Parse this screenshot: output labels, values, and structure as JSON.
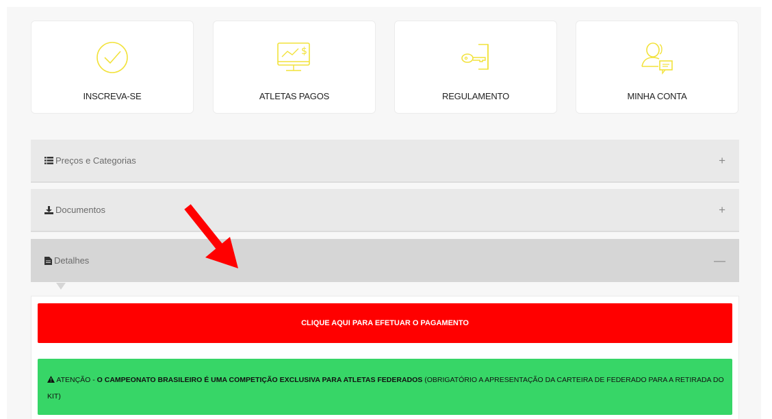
{
  "cards": [
    {
      "label": "INSCREVA-SE",
      "icon": "check-circle-icon"
    },
    {
      "label": "ATLETAS PAGOS",
      "icon": "monitor-money-icon"
    },
    {
      "label": "REGULAMENTO",
      "icon": "key-door-icon"
    },
    {
      "label": "MINHA CONTA",
      "icon": "user-chat-icon"
    }
  ],
  "accordion": {
    "items": [
      {
        "title": "Preços e Categorias",
        "icon": "list-icon",
        "toggle": "+"
      },
      {
        "title": "Documentos",
        "icon": "download-icon",
        "toggle": "+"
      },
      {
        "title": "Detalhes",
        "icon": "file-icon",
        "toggle": "—"
      }
    ]
  },
  "details": {
    "pay_button": "CLIQUE AQUI PARA EFETUAR O PAGAMENTO",
    "notice": {
      "prefix": "ATENÇÃO - ",
      "bold": "O CAMPEONATO BRASILEIRO É UMA COMPETIÇÃO EXCLUSIVA PARA ATLETAS FEDERADOS",
      "rest": " (OBRIGATÓRIO A APRESENTAÇÃO DA CARTEIRA DE FEDERADO PARA A RETIRADA DO KIT)"
    }
  },
  "colors": {
    "icon_yellow": "#f2e23a",
    "pay_red": "#ff0000",
    "notice_green": "#37d667",
    "arrow_red": "#ff0000"
  }
}
